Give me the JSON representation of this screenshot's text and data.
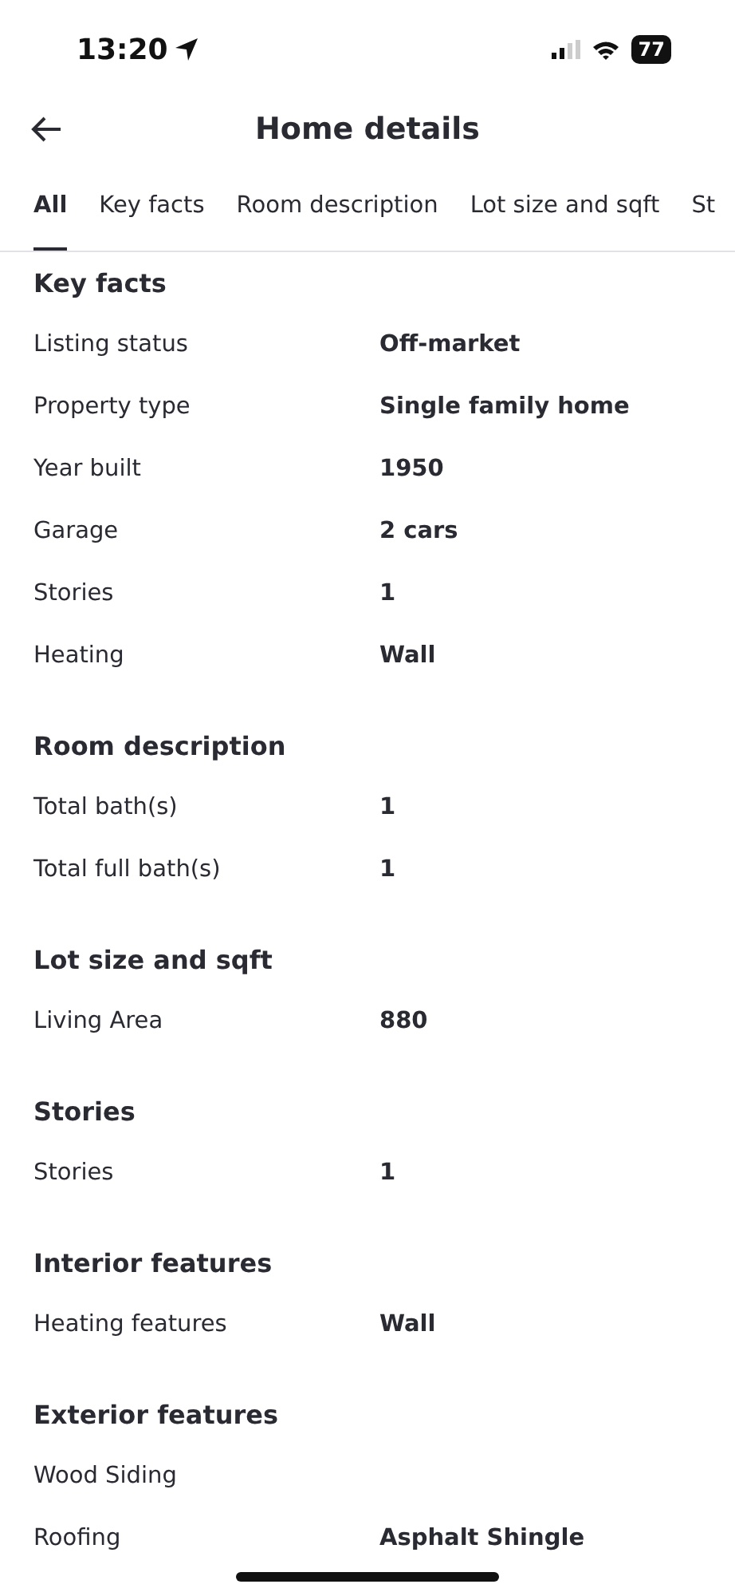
{
  "status_bar": {
    "time": "13:20",
    "battery": "77"
  },
  "header": {
    "title": "Home details"
  },
  "tabs": [
    {
      "label": "All",
      "selected": true
    },
    {
      "label": "Key facts",
      "selected": false
    },
    {
      "label": "Room description",
      "selected": false
    },
    {
      "label": "Lot size and sqft",
      "selected": false
    },
    {
      "label": "St",
      "selected": false
    }
  ],
  "sections": [
    {
      "title": "Key facts",
      "rows": [
        {
          "label": "Listing status",
          "value": "Off-market"
        },
        {
          "label": "Property type",
          "value": "Single family home"
        },
        {
          "label": "Year built",
          "value": "1950"
        },
        {
          "label": "Garage",
          "value": "2 cars"
        },
        {
          "label": "Stories",
          "value": "1"
        },
        {
          "label": "Heating",
          "value": "Wall"
        }
      ]
    },
    {
      "title": "Room description",
      "rows": [
        {
          "label": "Total bath(s)",
          "value": "1"
        },
        {
          "label": "Total full bath(s)",
          "value": "1"
        }
      ]
    },
    {
      "title": "Lot size and sqft",
      "rows": [
        {
          "label": "Living Area",
          "value": "880"
        }
      ]
    },
    {
      "title": "Stories",
      "rows": [
        {
          "label": "Stories",
          "value": "1"
        }
      ]
    },
    {
      "title": "Interior features",
      "rows": [
        {
          "label": "Heating features",
          "value": "Wall"
        }
      ]
    },
    {
      "title": "Exterior features",
      "rows": [
        {
          "label": "Wood Siding"
        },
        {
          "label": "Roofing",
          "value": "Asphalt Shingle"
        }
      ]
    }
  ]
}
